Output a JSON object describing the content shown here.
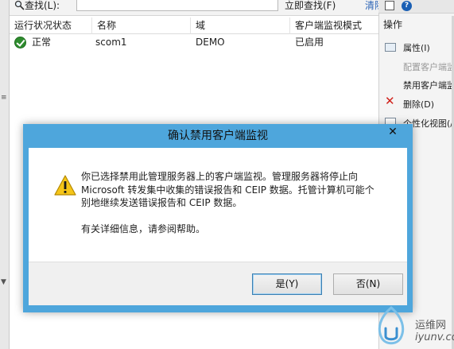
{
  "toolbar": {
    "find_label": "查找(L):",
    "find_value": "",
    "find_now_label": "立即查找(F)",
    "clear_label": "清除"
  },
  "table": {
    "columns": [
      "运行状况状态",
      "名称",
      "域",
      "客户端监视模式"
    ],
    "rows": [
      {
        "status": "正常",
        "name": "scom1",
        "domain": "DEMO",
        "mode": "已启用"
      }
    ]
  },
  "actions": {
    "title": "操作",
    "items": [
      {
        "label": "属性(I)",
        "enabled": true
      },
      {
        "label": "配置客户端监",
        "enabled": false
      },
      {
        "label": "禁用客户端监",
        "enabled": true
      },
      {
        "label": "删除(D)",
        "enabled": true
      },
      {
        "label": "个性化视图(/",
        "enabled": true
      }
    ]
  },
  "dialog": {
    "title": "确认禁用客户端监视",
    "close_glyph": "✕",
    "message_lines": [
      "你已选择禁用此管理服务器上的客户端监视。管理服务器将停止向",
      "Microsoft 转发集中收集的错误报告和 CEIP 数据。托管计算机可能个",
      "别地继续发送错误报告和 CEIP 数据。"
    ],
    "help_text": "有关详细信息，请参阅帮助。",
    "yes_label": "是(Y)",
    "no_label": "否(N)"
  },
  "watermark": {
    "cn": "运维网",
    "en": "iyunv.com"
  },
  "colors": {
    "dialog_frame": "#4ea6dc",
    "status_ok": "#2e8b2e",
    "delete_red": "#d0201a",
    "warning_yellow": "#f5c518"
  },
  "icons": {
    "search": "search-icon",
    "status_ok": "check-circle-icon",
    "warning": "warning-triangle-icon",
    "delete": "red-x-icon"
  }
}
